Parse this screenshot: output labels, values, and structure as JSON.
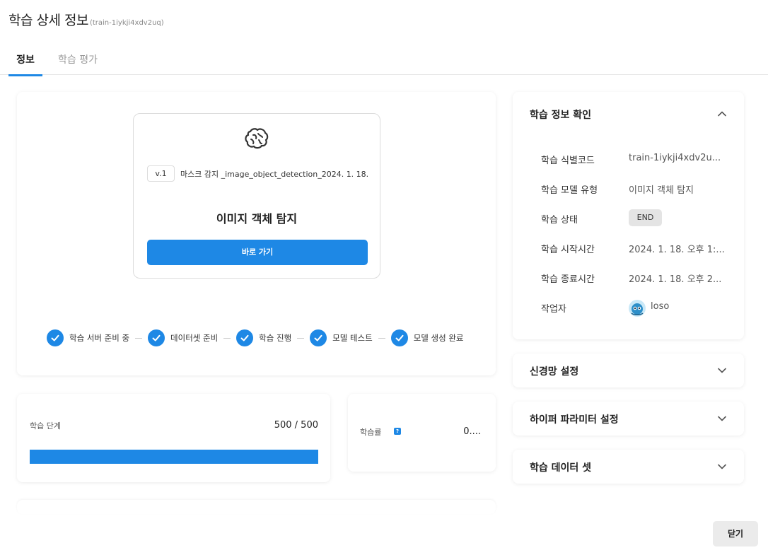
{
  "header": {
    "title": "학습 상세 정보",
    "train_id": "(train-1iykji4xdv2uq)"
  },
  "tabs": [
    {
      "label": "정보",
      "active": true
    },
    {
      "label": "학습 평가",
      "active": false
    }
  ],
  "model_card": {
    "icon": "brain-icon",
    "version": "v.1",
    "name": "마스크 감지 _image_object_detection_2024. 1. 18.",
    "type": "이미지 객체 탐지",
    "go_button": "바로 가기"
  },
  "steps": [
    {
      "label": "학습 서버 준비 중",
      "done": true
    },
    {
      "label": "데이터셋 준비",
      "done": true
    },
    {
      "label": "학습 진행",
      "done": true
    },
    {
      "label": "모델 테스트",
      "done": true
    },
    {
      "label": "모델 생성 완료",
      "done": true
    }
  ],
  "progress": {
    "label": "학습 단계",
    "count_text": "500 / 500",
    "fraction": 1.0
  },
  "learning_rate": {
    "label": "학습률",
    "help_icon": "help-icon",
    "help_glyph": "?",
    "value": "0...."
  },
  "info_panel": {
    "title": "학습 정보 확인",
    "rows": [
      {
        "key": "학습 식별코드",
        "value": "train-1iykji4xdv2u..."
      },
      {
        "key": "학습 모델 유형",
        "value": "이미지 객체 탐지"
      },
      {
        "key": "학습 상태",
        "value": "END"
      },
      {
        "key": "학습 시작시간",
        "value": "2024. 1. 18. 오후 1:..."
      },
      {
        "key": "학습 종료시간",
        "value": "2024. 1. 18. 오후 2..."
      },
      {
        "key": "작업자",
        "value": "loso"
      }
    ]
  },
  "accordions": [
    {
      "title": "신경망 설정"
    },
    {
      "title": "하이퍼 파라미터 설정"
    },
    {
      "title": "학습 데이터 셋"
    }
  ],
  "close_button": "닫기",
  "colors": {
    "accent": "#1e88e5",
    "badge_bg": "#e4e4e4"
  }
}
